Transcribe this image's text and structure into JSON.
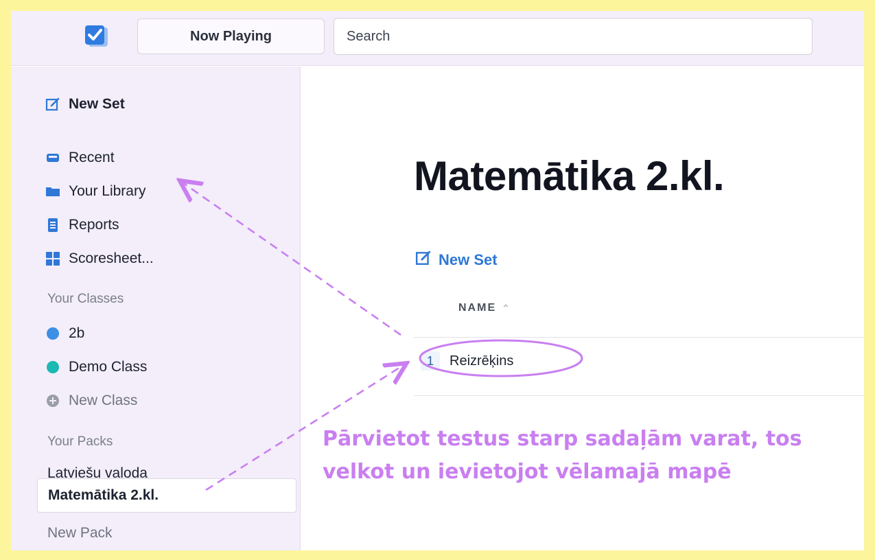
{
  "topbar": {
    "now_playing_label": "Now Playing",
    "search_placeholder": "Search",
    "logo_icon": "checkbox-logo-icon"
  },
  "sidebar": {
    "new_set_label": "New Set",
    "nav": [
      {
        "label": "Recent",
        "icon": "inbox-icon"
      },
      {
        "label": "Your Library",
        "icon": "folder-icon"
      },
      {
        "label": "Reports",
        "icon": "document-icon"
      },
      {
        "label": "Scoresheet...",
        "icon": "grid-icon"
      }
    ],
    "classes_heading": "Your Classes",
    "classes": [
      {
        "label": "2b",
        "color": "#3d8fe6"
      },
      {
        "label": "Demo Class",
        "color": "#1cb8b3"
      }
    ],
    "new_class_label": "New Class",
    "packs_heading": "Your Packs",
    "packs": [
      {
        "label": "Latviešu valoda"
      },
      {
        "label": "Matemātika 2.kl.",
        "active": true
      }
    ],
    "new_pack_label": "New Pack"
  },
  "main": {
    "title": "Matemātika 2.kl.",
    "new_set_label": "New Set",
    "column_header": "NAME",
    "rows": [
      {
        "index": "1",
        "name": "Reizrēķins"
      }
    ]
  },
  "annotation": {
    "line1": "Pārvietot testus starp sadaļām varat, tos",
    "line2": "velkot un ievietojot vēlamajā mapē",
    "color": "#c97ff0"
  },
  "colors": {
    "background_frame": "#fdf59c",
    "sidebar_bg": "#f3eefa",
    "accent_blue": "#2f78d6"
  }
}
